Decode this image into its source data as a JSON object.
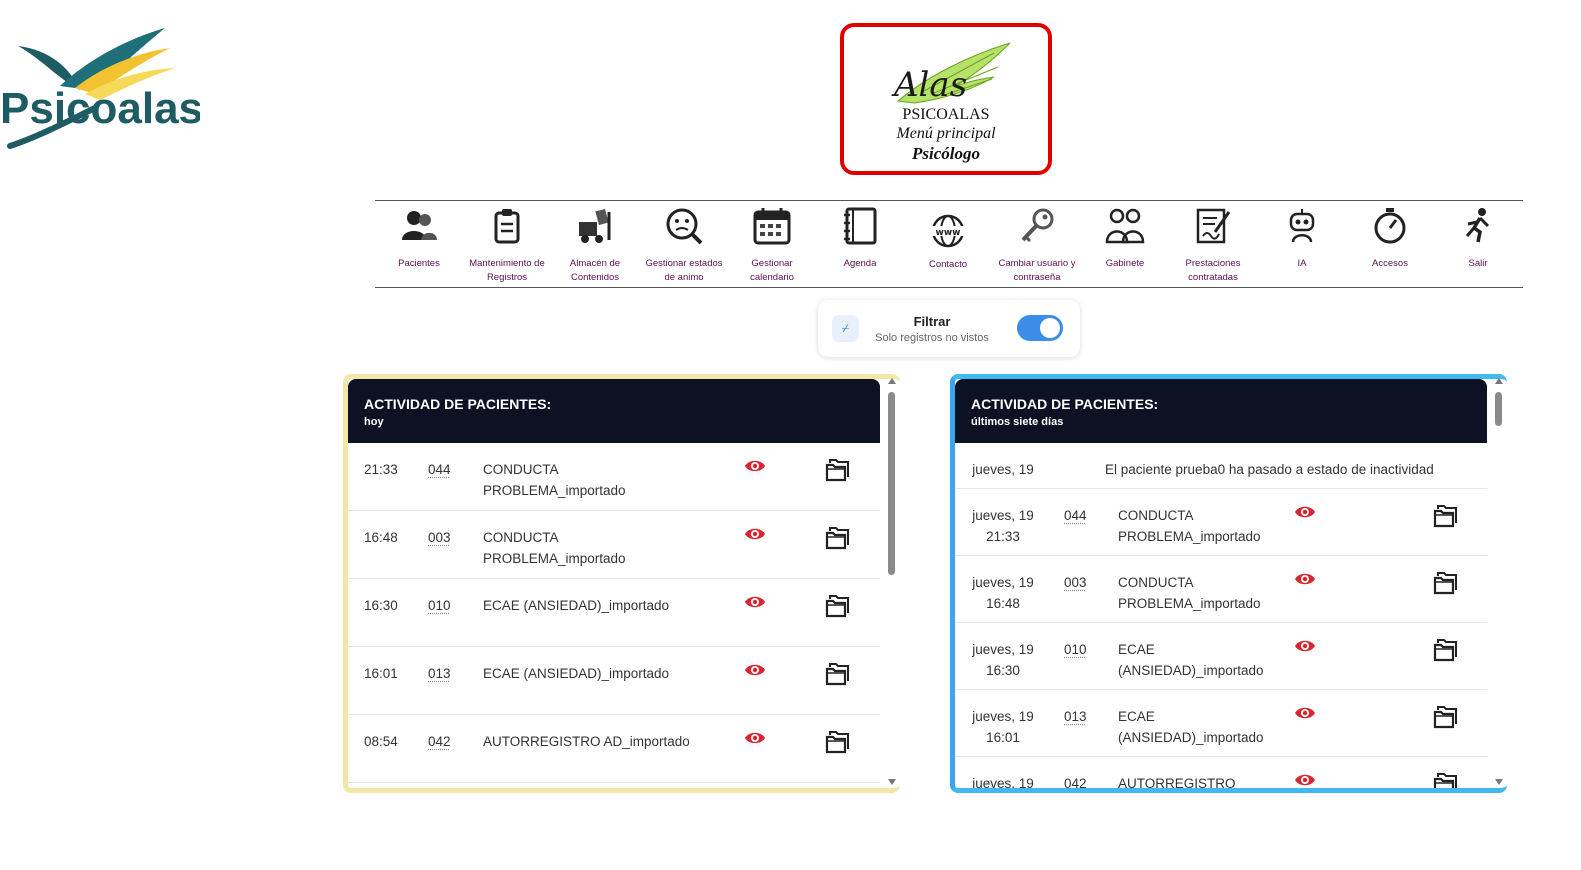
{
  "logo": {
    "text": "Psicoalas"
  },
  "title_box": {
    "brand": "Alas",
    "line1": "PSICOALAS",
    "line2": "Menú principal",
    "line3": "Psicólogo"
  },
  "menu": [
    {
      "label": "Pacientes",
      "icon": "patients-icon"
    },
    {
      "label": "Mantenimiento de Registros",
      "icon": "clipboard-icon"
    },
    {
      "label": "Almacén de Contenidos",
      "icon": "forklift-icon"
    },
    {
      "label": "Gestionar estados de animo",
      "icon": "mood-search-icon"
    },
    {
      "label": "Gestionar calendario",
      "icon": "calendar-icon"
    },
    {
      "label": "Agenda",
      "icon": "agenda-icon"
    },
    {
      "label": "Contacto",
      "icon": "globe-www-icon"
    },
    {
      "label": "Cambiar usuario y contraseña",
      "icon": "key-icon"
    },
    {
      "label": "Gabinete",
      "icon": "doctors-icon"
    },
    {
      "label": "Prestaciones contratadas",
      "icon": "contract-sign-icon"
    },
    {
      "label": "IA",
      "icon": "robot-icon"
    },
    {
      "label": "Accesos",
      "icon": "stopwatch-icon"
    },
    {
      "label": "Salir",
      "icon": "running-man-icon"
    }
  ],
  "filter": {
    "icon_glyph": "⌿",
    "title": "Filtrar",
    "subtitle": "Solo registros no vistos",
    "enabled": true
  },
  "left_panel": {
    "title": "ACTIVIDAD DE PACIENTES:",
    "subtitle": "hoy",
    "rows": [
      {
        "time": "21:33",
        "code": "044",
        "desc": [
          "CONDUCTA",
          "PROBLEMA_importado"
        ]
      },
      {
        "time": "16:48",
        "code": "003",
        "desc": [
          "CONDUCTA",
          "PROBLEMA_importado"
        ]
      },
      {
        "time": "16:30",
        "code": "010",
        "desc": [
          "ECAE (ANSIEDAD)_importado"
        ]
      },
      {
        "time": "16:01",
        "code": "013",
        "desc": [
          "ECAE (ANSIEDAD)_importado"
        ]
      },
      {
        "time": "08:54",
        "code": "042",
        "desc": [
          "AUTORREGISTRO AD_importado"
        ]
      }
    ]
  },
  "right_panel": {
    "title": "ACTIVIDAD DE PACIENTES:",
    "subtitle": "últimos siete días",
    "notice": {
      "day": "jueves, 19",
      "message": "El paciente prueba0 ha pasado a estado de inactividad"
    },
    "rows": [
      {
        "day": "jueves, 19",
        "time": "21:33",
        "code": "044",
        "desc": [
          "CONDUCTA",
          "PROBLEMA_importado"
        ]
      },
      {
        "day": "jueves, 19",
        "time": "16:48",
        "code": "003",
        "desc": [
          "CONDUCTA",
          "PROBLEMA_importado"
        ]
      },
      {
        "day": "jueves, 19",
        "time": "16:30",
        "code": "010",
        "desc": [
          "ECAE",
          "(ANSIEDAD)_importado"
        ]
      },
      {
        "day": "jueves, 19",
        "time": "16:01",
        "code": "013",
        "desc": [
          "ECAE",
          "(ANSIEDAD)_importado"
        ]
      },
      {
        "day": "jueves, 19",
        "time": "",
        "code": "042",
        "desc": [
          "AUTORREGISTRO"
        ]
      }
    ]
  },
  "colors": {
    "eye": "#d9252f",
    "menu_label": "#5a1050",
    "panel_header": "#0c1224",
    "left_border": "#f2e7a6",
    "right_border": "#3fb9f0",
    "toggle": "#3b8de8",
    "title_border": "#e00000"
  }
}
